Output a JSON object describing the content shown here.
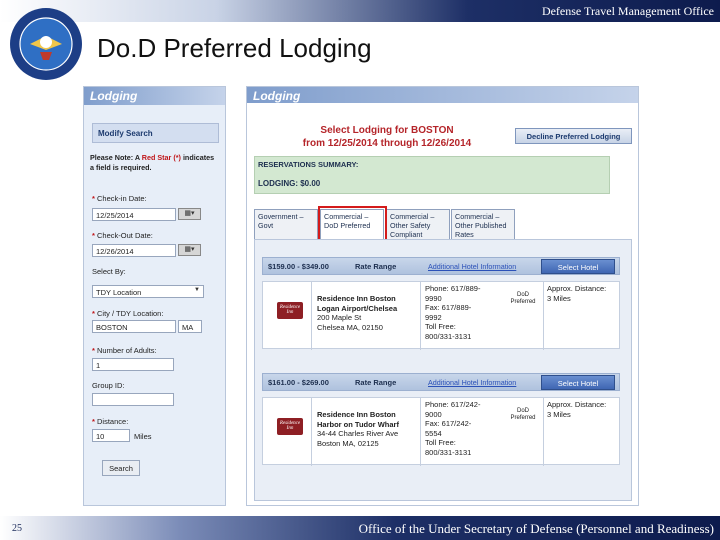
{
  "slide": {
    "title": "Do.D Preferred Lodging",
    "header_office": "Defense Travel Management Office",
    "footer_office": "Office of the Under Secretary of Defense (Personnel and Readiness)",
    "slide_number": "25"
  },
  "left_panel": {
    "header": "Lodging",
    "modify_search": "Modify Search",
    "note_prefix": "Please Note: A ",
    "note_red": "Red Star (*)",
    "note_suffix": "indicates a field is required.",
    "checkin_label": "Check-in Date:",
    "checkin_value": "12/25/2014",
    "checkout_label": "Check-Out Date:",
    "checkout_value": "12/26/2014",
    "select_by_label": "Select By:",
    "select_by_value": "TDY Location",
    "city_label": "City / TDY Location:",
    "city_value": "BOSTON",
    "state_value": "MA",
    "adults_label": "Number of Adults:",
    "adults_value": "1",
    "group_label": "Group ID:",
    "group_value": "",
    "distance_label": "Distance:",
    "distance_value": "10",
    "distance_unit": "Miles",
    "search_button": "Search",
    "star": "*"
  },
  "right_panel": {
    "header": "Lodging",
    "select_title_1": "Select Lodging for BOSTON",
    "select_title_2": "from 12/25/2014 through 12/26/2014",
    "decline_button": "Decline Preferred Lodging",
    "res_summary_label": "RESERVATIONS SUMMARY:",
    "lodging_label": "LODGING:   $0.00",
    "tabs": [
      {
        "label": "Government – Govt"
      },
      {
        "label": "Commercial – DoD Preferred"
      },
      {
        "label": "Commercial – Other Safety Compliant"
      },
      {
        "label": "Commercial – Other Published Rates"
      }
    ],
    "hotels": [
      {
        "price_range": "$159.00 - $349.00",
        "rate_range_label": "Rate Range",
        "additional_info": "Additional Hotel Information",
        "select_button": "Select Hotel",
        "name": "Residence Inn Boston Logan Airport/Chelsea",
        "address_line": "200 Maple St",
        "city_line": "Chelsea MA, 02150",
        "phone_lines": [
          "Phone: 617/889-",
          "9990",
          "Fax: 617/889-",
          "9992",
          "Toll Free:",
          "800/331-3131"
        ],
        "badge": "DoD Preferred",
        "approx": "Approx. Distance:",
        "distance": "3 Miles"
      },
      {
        "price_range": "$161.00 - $269.00",
        "rate_range_label": "Rate Range",
        "additional_info": "Additional Hotel Information",
        "select_button": "Select Hotel",
        "name": "Residence Inn Boston Harbor on Tudor Wharf",
        "address_line": "34-44 Charles River Ave",
        "city_line": "Boston MA, 02125",
        "phone_lines": [
          "Phone: 617/242-",
          "9000",
          "Fax: 617/242-",
          "5554",
          "Toll Free:",
          "800/331-3131"
        ],
        "badge": "DoD Preferred",
        "approx": "Approx. Distance:",
        "distance": "3 Miles"
      }
    ]
  }
}
